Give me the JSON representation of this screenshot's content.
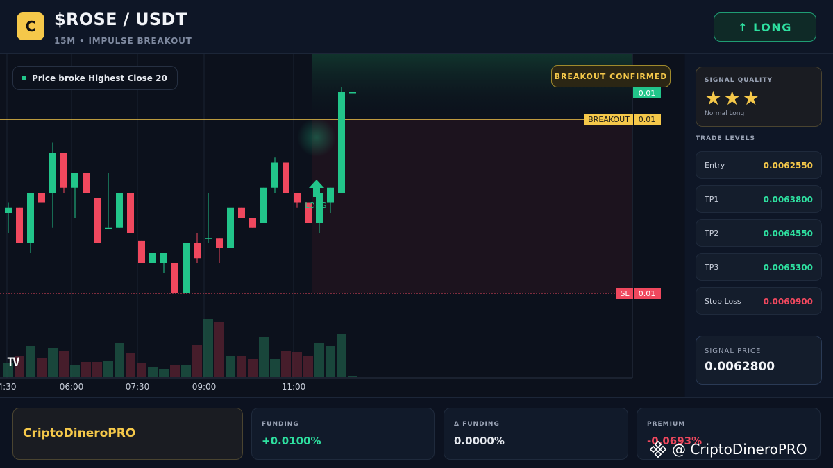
{
  "header": {
    "logo_letter": "C",
    "title": "$ROSE / USDT",
    "subtitle": "15M • IMPULSE BREAKOUT",
    "long_button": "↑ LONG"
  },
  "chart": {
    "chip_text": "Price broke Highest Close 20",
    "confirmed": "BREAKOUT CONFIRMED",
    "breakout_label": "BREAKOUT",
    "breakout_value": "0.01",
    "top_value": "0.01",
    "sl_label": "SL",
    "sl_value": "0.01",
    "long_marker": "LONG",
    "time_labels": [
      "4:30",
      "06:00",
      "07:30",
      "09:00",
      "11:00"
    ],
    "tv_logo": "TV"
  },
  "chart_data": {
    "type": "candlestick",
    "time_ticks": [
      "4:30",
      "06:00",
      "07:30",
      "09:00",
      "11:00"
    ],
    "annotations": [
      {
        "label": "BREAKOUT",
        "value": "0.01"
      },
      {
        "label": "SL",
        "value": "0.01"
      }
    ],
    "series": [
      {
        "name": "price",
        "ohlc": [
          [
            0.00632,
            0.00636,
            0.00624,
            0.00634
          ],
          [
            0.00634,
            0.00634,
            0.0062,
            0.0062
          ],
          [
            0.0062,
            0.0064,
            0.00616,
            0.0064
          ],
          [
            0.0064,
            0.0064,
            0.00636,
            0.00636
          ],
          [
            0.0064,
            0.0066,
            0.00626,
            0.00656
          ],
          [
            0.00656,
            0.00656,
            0.0064,
            0.00642
          ],
          [
            0.00642,
            0.00648,
            0.0063,
            0.00648
          ],
          [
            0.00648,
            0.00648,
            0.0064,
            0.0064
          ],
          [
            0.00638,
            0.00638,
            0.0062,
            0.0062
          ],
          [
            0.00626,
            0.00648,
            0.00626,
            0.00626
          ],
          [
            0.00626,
            0.0064,
            0.00626,
            0.0064
          ],
          [
            0.0064,
            0.0064,
            0.00624,
            0.00624
          ],
          [
            0.00621,
            0.00621,
            0.00612,
            0.00612
          ],
          [
            0.00612,
            0.00616,
            0.00612,
            0.00616
          ],
          [
            0.00612,
            0.00616,
            0.00608,
            0.00616
          ],
          [
            0.00612,
            0.00612,
            0.006,
            0.006
          ],
          [
            0.006,
            0.0062,
            0.006,
            0.0062
          ],
          [
            0.0062,
            0.00624,
            0.00612,
            0.00614
          ],
          [
            0.00622,
            0.0064,
            0.0062,
            0.00622
          ],
          [
            0.00622,
            0.00622,
            0.00612,
            0.00618
          ],
          [
            0.00618,
            0.0063,
            0.00618,
            0.00634
          ],
          [
            0.00634,
            0.00634,
            0.0063,
            0.0063
          ],
          [
            0.0063,
            0.0063,
            0.00626,
            0.00626
          ],
          [
            0.00628,
            0.00642,
            0.00628,
            0.00642
          ],
          [
            0.00642,
            0.00654,
            0.0064,
            0.00652
          ],
          [
            0.00652,
            0.00652,
            0.0064,
            0.0064
          ],
          [
            0.0064,
            0.0064,
            0.00634,
            0.00636
          ],
          [
            0.00636,
            0.00636,
            0.00628,
            0.00628
          ],
          [
            0.00628,
            0.00636,
            0.00624,
            0.0064
          ],
          [
            0.00636,
            0.00642,
            0.00632,
            0.00642
          ],
          [
            0.0064,
            0.00682,
            0.0064,
            0.0068
          ],
          [
            0.0068,
            0.0068,
            0.0068,
            0.0068
          ]
        ]
      }
    ]
  },
  "side": {
    "quality_label": "SIGNAL QUALITY",
    "stars": "★★★",
    "quality_sub": "Normal Long",
    "levels_label": "TRADE LEVELS",
    "levels": [
      {
        "name": "Entry",
        "value": "0.0062550",
        "color": "#f5c84a"
      },
      {
        "name": "TP1",
        "value": "0.0063800",
        "color": "#2ee0a0"
      },
      {
        "name": "TP2",
        "value": "0.0064550",
        "color": "#2ee0a0"
      },
      {
        "name": "TP3",
        "value": "0.0065300",
        "color": "#2ee0a0"
      },
      {
        "name": "Stop Loss",
        "value": "0.0060900",
        "color": "#f0485e"
      }
    ],
    "signal_price_label": "SIGNAL PRICE",
    "signal_price": "0.0062800"
  },
  "bottom": {
    "brand": "CriptoDineroPRO",
    "stats": [
      {
        "label": "FUNDING",
        "value": "+0.0100%",
        "color": "#2ee0a0"
      },
      {
        "label": "Δ FUNDING",
        "value": "0.0000%",
        "color": "#e6e9ef"
      },
      {
        "label": "PREMIUM",
        "value": "-0.0693%",
        "color": "#f0485e"
      }
    ]
  },
  "watermark": "@ CriptoDineroPRO",
  "colors": {
    "up": "#22c58a",
    "down": "#f0485e",
    "accent": "#f5c84a"
  }
}
